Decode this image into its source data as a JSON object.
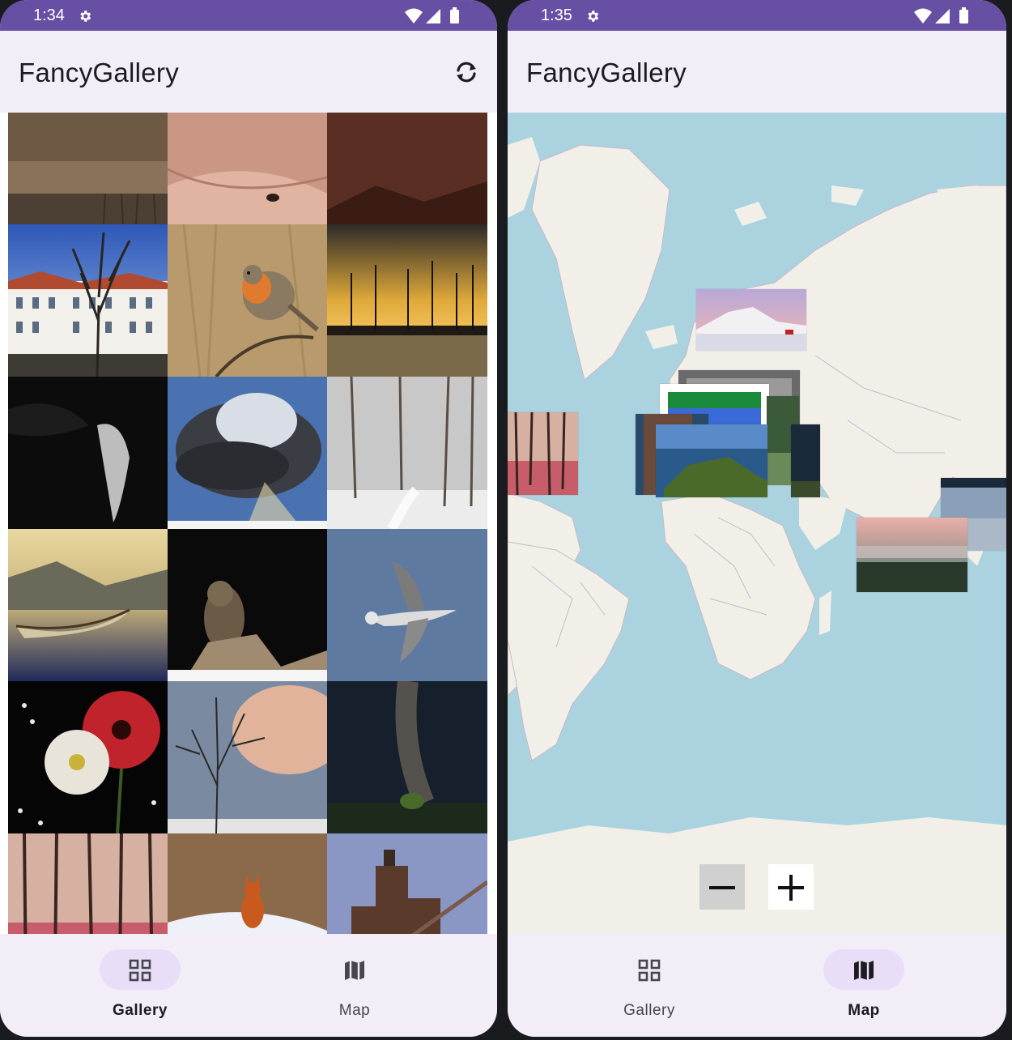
{
  "left_screen": {
    "status_time": "1:34",
    "app_title": "FancyGallery",
    "nav": [
      {
        "label": "Gallery",
        "active": true
      },
      {
        "label": "Map",
        "active": false
      }
    ]
  },
  "right_screen": {
    "status_time": "1:35",
    "app_title": "FancyGallery",
    "nav": [
      {
        "label": "Gallery",
        "active": false
      },
      {
        "label": "Map",
        "active": true
      }
    ]
  },
  "gallery_photos": [
    "lake-shore-photo",
    "sand-dunes-photo",
    "dusk-hills-photo",
    "palace-photo",
    "robin-photo",
    "sunset-forest-photo",
    "dark-portrait-photo",
    "storm-cloud-photo",
    "snowy-forest-photo",
    "rowing-boat-photo",
    "owl-photo",
    "seagull-photo",
    "gerbera-flowers-photo",
    "winter-tree-sky-photo",
    "milky-way-photo",
    "autumn-forest-photo",
    "fox-in-snow-photo",
    "steel-works-photo"
  ],
  "icons": {
    "settings": "gear-icon",
    "sync": "sync-icon",
    "gallery": "grid-icon",
    "map": "map-icon",
    "zoom_out": "minus-icon",
    "zoom_in": "plus-icon"
  },
  "colors": {
    "status_bar": "#6750a4",
    "app_bar": "#f3edf7",
    "active_pill": "#e8def8",
    "ocean": "#aad3df",
    "land": "#f2efe9"
  }
}
